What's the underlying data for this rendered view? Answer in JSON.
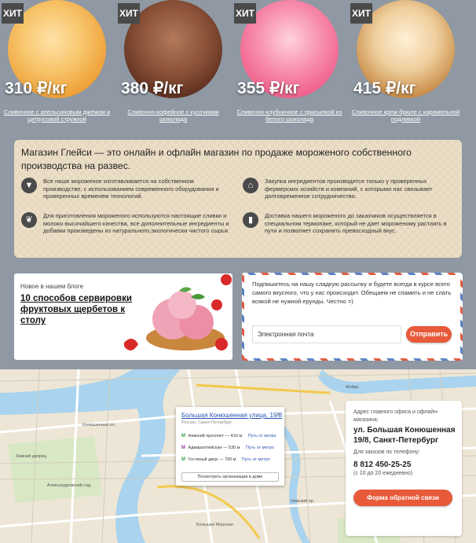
{
  "products": [
    {
      "badge": "ХИТ",
      "price": "310 ₽/кг",
      "name": "Сливочное с апельсиновым джемом и цитрусовой стружкой",
      "color": "#f3b24d"
    },
    {
      "badge": "ХИТ",
      "price": "380 ₽/кг",
      "name": "Сливочно-кофейное с кусочками шоколада",
      "color": "#7a4530"
    },
    {
      "badge": "ХИТ",
      "price": "355 ₽/кг",
      "name": "Сливочно-клубничное с присыпкой из белого шоколада",
      "color": "#f06d95"
    },
    {
      "badge": "ХИТ",
      "price": "415 ₽/кг",
      "name": "Сливочное крем-брюле с карамельной подливкой",
      "color": "#d9a76a"
    }
  ],
  "info": {
    "title": "Магазин Глейси — это онлайн и офлайн магазин по продаже мороженого собственного производства на развес.",
    "features": [
      {
        "icon": "ice-cream-icon",
        "text": "Все наше мороженое изготавливается на собственном производстве, с использованием современного оборудования и проверенных временем технологий."
      },
      {
        "icon": "farm-icon",
        "text": "Закупка ингредиентов производится только у проверенных фермерских хозяйств и компаний, с которыми нас связывает долговременное сотрудничество."
      },
      {
        "icon": "leaf-icon",
        "text": "Для приготовления мороженого используются настоящие сливки и молоко высочайшего качества, все дополнительные ингредиенты и добавки произведены из натурального,экологически чистого сырья."
      },
      {
        "icon": "thermos-icon",
        "text": "Доставка нашего мороженого до заказчиков осуществляется в специальном термопаке, который не дает мороженому растаять в пути и позволяет сохранить превосходный вкус."
      }
    ]
  },
  "blog": {
    "kicker": "Новое в нашем блоге",
    "headline": "10 способов сервировки фруктовых щербетов к столу"
  },
  "newsletter": {
    "text": "Подпишитесь на нашу сладкую рассылку и будете всегда в курсе всего самого вкусного, что у нас происходит. Обещаем не спамить и не слать всякой не нужной ерунды. Честно =)",
    "placeholder": "Электронная почта",
    "button": "Отправить"
  },
  "map": {
    "popup": {
      "address": "Большая Конюшенная улица, 19/8",
      "city": "Россия, Санкт-Петербург",
      "close": "×",
      "metro": [
        {
          "marker": "M",
          "color": "#3aa14a",
          "station": "Невский проспект — 410 м",
          "link": "Путь от метро"
        },
        {
          "marker": "M",
          "color": "#9c3aa1",
          "station": "Адмиралтейская — 530 м",
          "link": "Путь от метро"
        },
        {
          "marker": "M",
          "color": "#3aa14a",
          "station": "Гостиный двор — 790 м",
          "link": "Путь от метро"
        }
      ],
      "orgs_button": "Посмотреть организации в доме"
    },
    "labels": [
      "Летний сад",
      "Михайловский замок",
      "Александровский сад",
      "Исаакиевская пл.",
      "Мойка",
      "Конюшенная пл.",
      "Зимний дворец",
      "Невский пр.",
      "Гостиный двор",
      "Большая Морская",
      "Малая Садовая",
      "ул. Восстания"
    ],
    "contact": {
      "label1": "Адрес главного офиса и офлайн-магазина:",
      "address": "ул. Большая Конюшенная 19/8, Санкт-Петербург",
      "label2": "Для заказов по телефону:",
      "phone": "8 812 450-25-25",
      "hours": "(с 10 до 20 ежедневно)",
      "button": "Форма обратной связи"
    }
  }
}
